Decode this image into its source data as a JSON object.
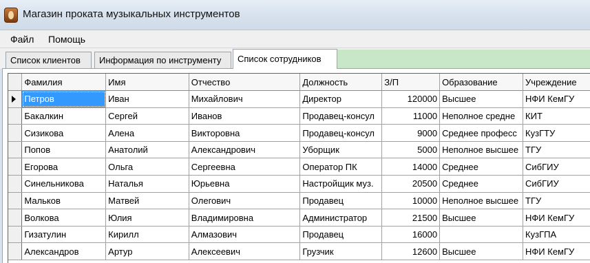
{
  "window": {
    "title": "Магазин проката музыкальных инструментов",
    "icon": "music-shop-icon"
  },
  "menu": {
    "file": "Файл",
    "help": "Помощь"
  },
  "tabs": [
    {
      "label": "Список клиентов",
      "active": false
    },
    {
      "label": "Информация по инструменту",
      "active": false
    },
    {
      "label": "Список сотрудников",
      "active": true
    }
  ],
  "table": {
    "columns": [
      "Фамилия",
      "Имя",
      "Отчество",
      "Должность",
      "З/П",
      "Образование",
      "Учреждение"
    ],
    "rows": [
      [
        "Петров",
        "Иван",
        "Михайлович",
        "Директор",
        "120000",
        "Высшее",
        "НФИ КемГУ"
      ],
      [
        "Бакалкин",
        "Сергей",
        "Иванов",
        "Продавец-консул",
        "11000",
        "Неполное средне",
        "КИТ"
      ],
      [
        "Сизикова",
        "Алена",
        "Викторовна",
        "Продавец-консул",
        "9000",
        "Среднее професс",
        "КузГТУ"
      ],
      [
        "Попов",
        "Анатолий",
        "Александрович",
        "Уборщик",
        "5000",
        "Неполное высшее",
        "ТГУ"
      ],
      [
        "Егорова",
        "Ольга",
        "Сергеевна",
        "Оператор ПК",
        "14000",
        "Среднее",
        "СибГИУ"
      ],
      [
        "Синельникова",
        "Наталья",
        "Юрьевна",
        "Настройщик муз.",
        "20500",
        "Среднее",
        "СибГИУ"
      ],
      [
        "Мальков",
        "Матвей",
        "Олегович",
        "Продавец",
        "10000",
        "Неполное высшее",
        "ТГУ"
      ],
      [
        "Волкова",
        "Юлия",
        "Владимировна",
        "Администратор",
        "21500",
        "Высшее",
        "НФИ КемГУ"
      ],
      [
        "Гизатулин",
        "Кирилл",
        "Алмазович",
        "Продавец",
        "16000",
        "",
        "КузГПА"
      ],
      [
        "Александров",
        "Артур",
        "Алексеевич",
        "Грузчик",
        "12600",
        "Высшее",
        "НФИ КемГУ"
      ]
    ],
    "selected_row": 0,
    "selection_color": "#3399ff"
  },
  "colors": {
    "tab_filler": "#c8e6c8",
    "titlebar": "#d6e1ed"
  }
}
